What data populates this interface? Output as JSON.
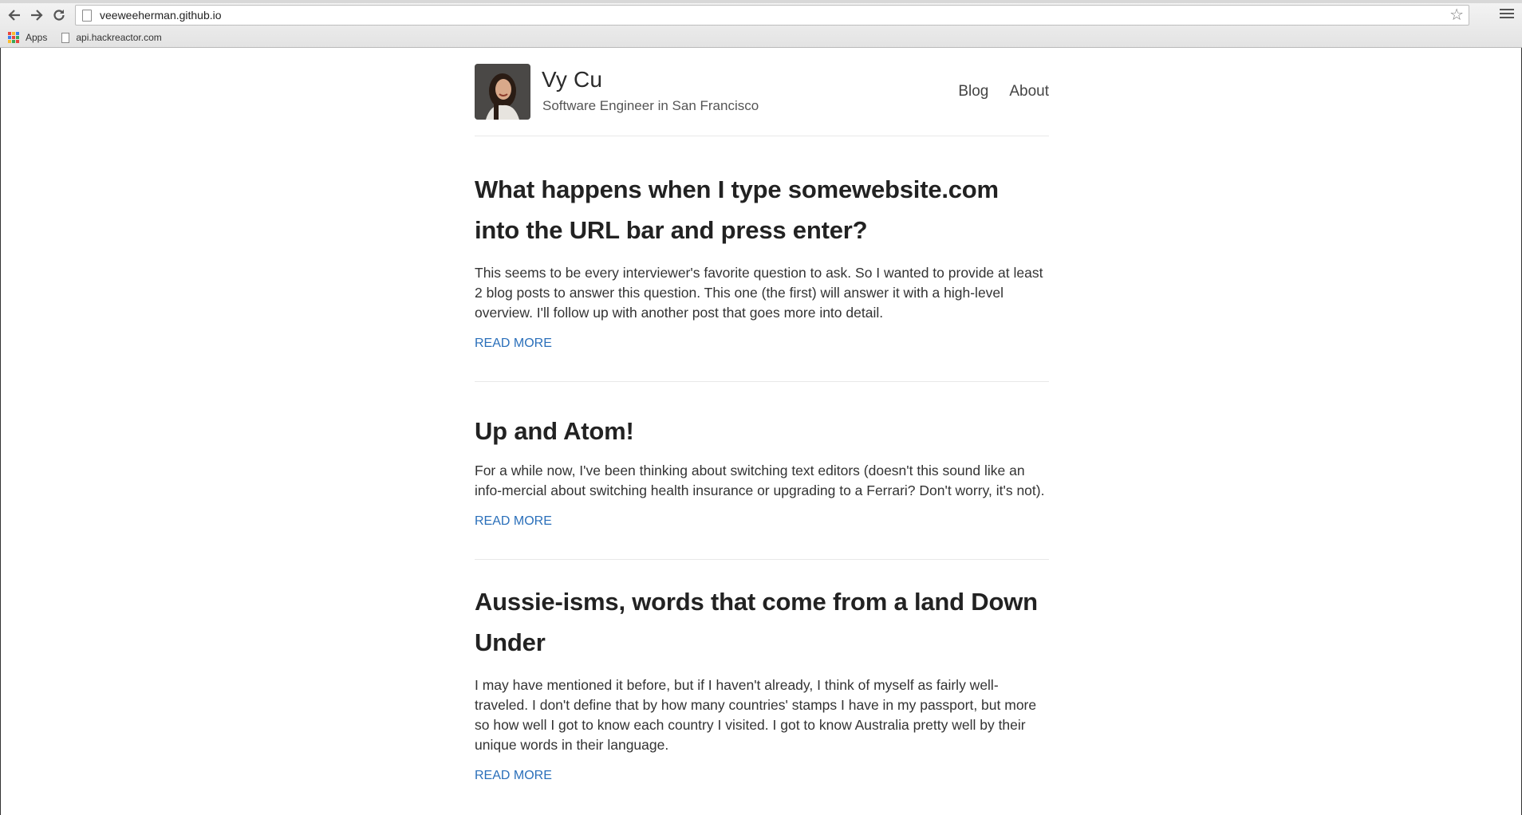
{
  "browser": {
    "url": "veeweeherman.github.io",
    "bookmarks": [
      {
        "label": "Apps",
        "icon": "apps-grid-icon"
      },
      {
        "label": "api.hackreactor.com",
        "icon": "page-icon"
      }
    ],
    "icons": {
      "back": "back-arrow-icon",
      "forward": "forward-arrow-icon",
      "reload": "reload-icon",
      "star": "star-icon",
      "menu": "hamburger-menu-icon"
    }
  },
  "site": {
    "title": "Vy Cu",
    "description": "Software Engineer in San Francisco",
    "nav": [
      {
        "label": "Blog"
      },
      {
        "label": "About"
      }
    ]
  },
  "posts": [
    {
      "title": "What happens when I type somewebsite.com into the URL bar and press enter?",
      "excerpt": "This seems to be every interviewer's favorite question to ask. So I wanted to provide at least 2 blog posts to answer this question. This one (the first) will answer it with a high-level overview. I'll follow up with another post that goes more into detail.",
      "read_more": "READ MORE"
    },
    {
      "title": "Up and Atom!",
      "excerpt": "For a while now, I've been thinking about switching text editors (doesn't this sound like an info-mercial about switching health insurance or upgrading to a Ferrari? Don't worry, it's not).",
      "read_more": "READ MORE"
    },
    {
      "title": "Aussie-isms, words that come from a land Down Under",
      "excerpt": "I may have mentioned it before, but if I haven't already, I think of myself as fairly well-traveled. I don't define that by how many countries' stamps I have in my passport, but more so how well I got to know each country I visited. I got to know Australia pretty well by their unique words in their language.",
      "read_more": "READ MORE"
    }
  ],
  "colors": {
    "link": "#2a6fba",
    "text": "#333333",
    "heading": "#222222"
  }
}
